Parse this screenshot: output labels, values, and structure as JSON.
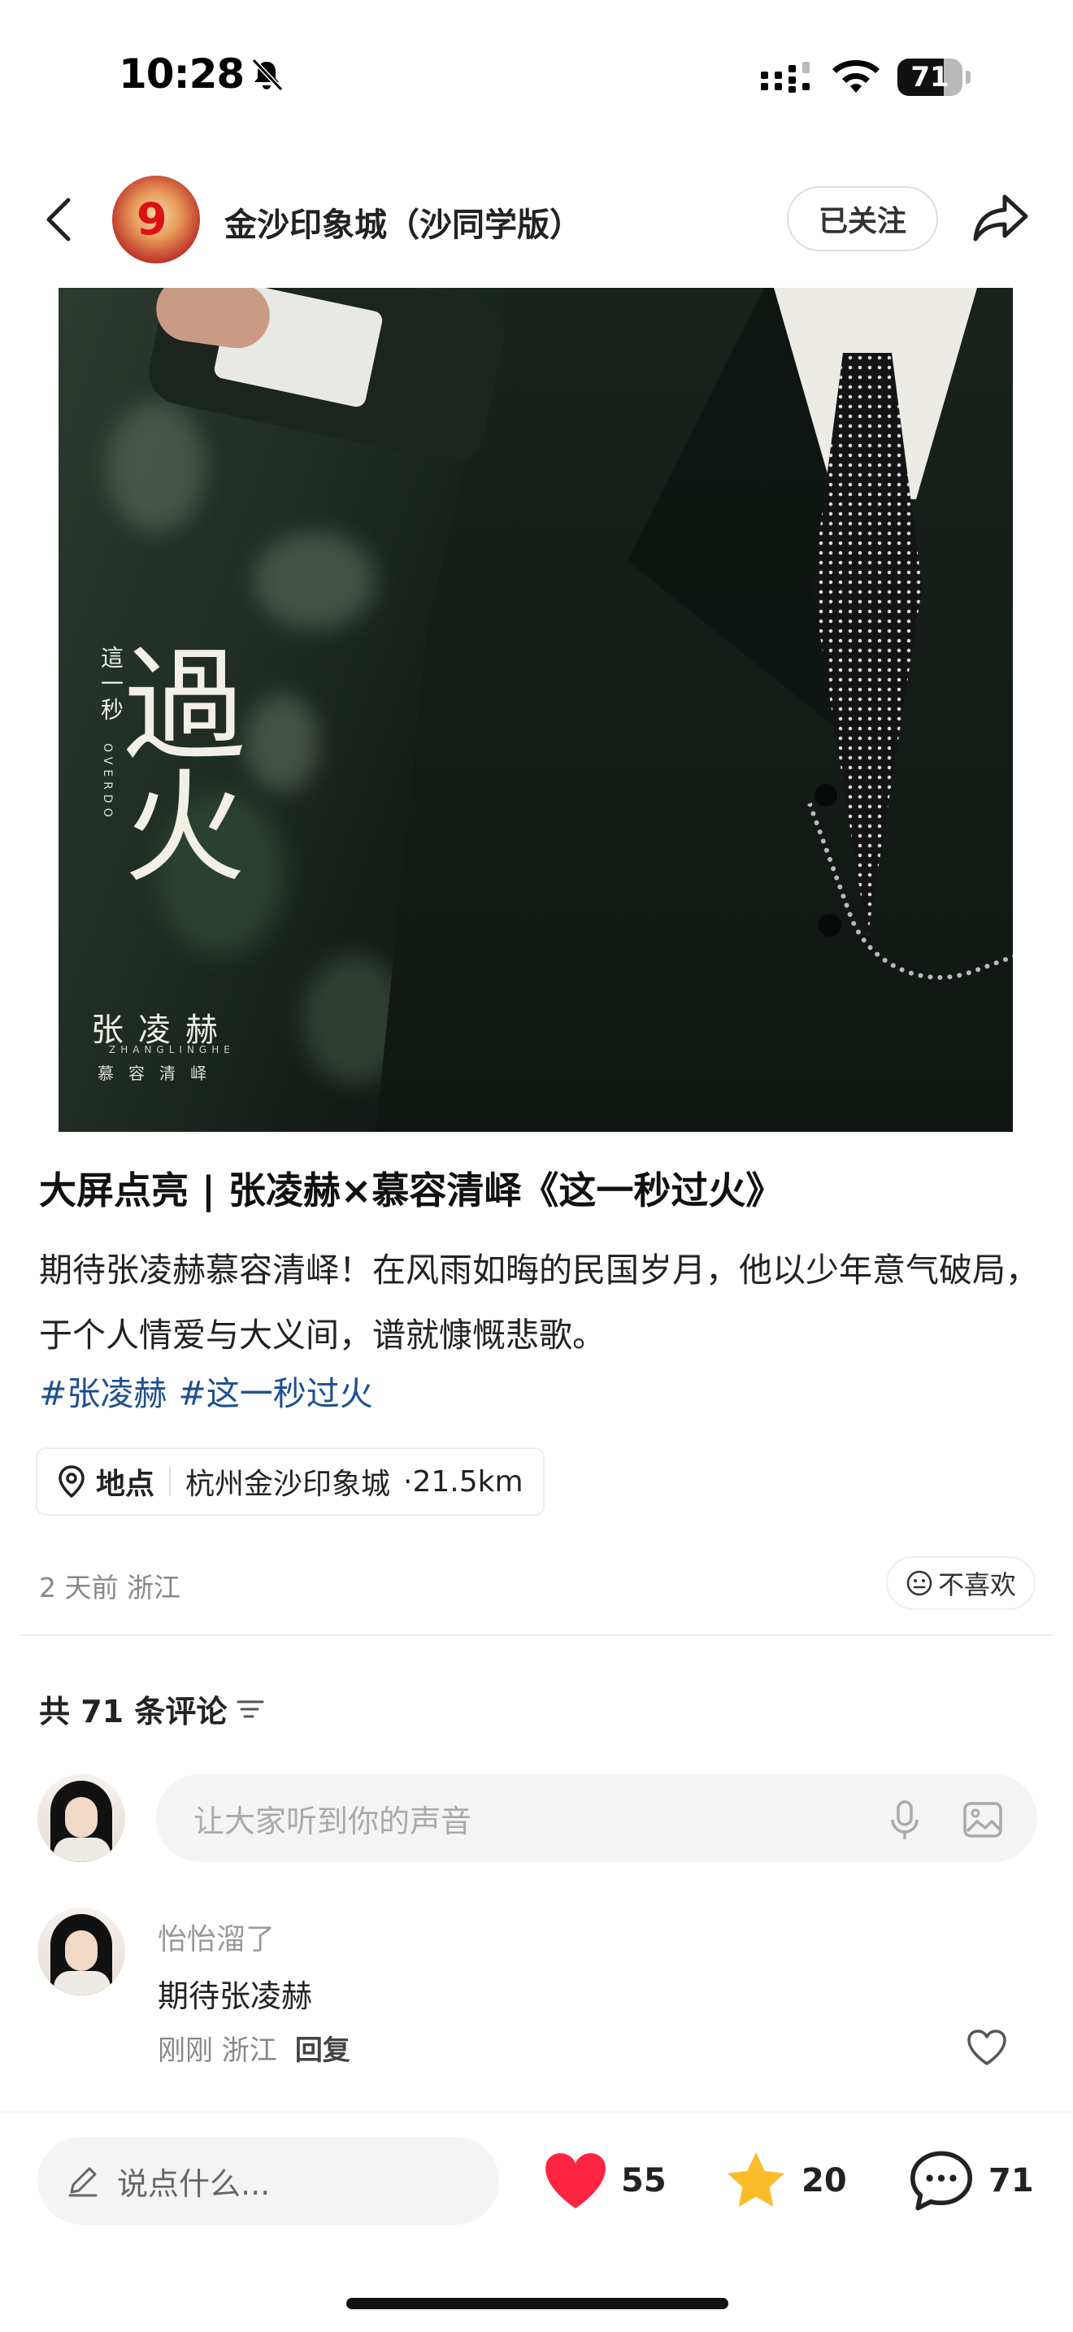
{
  "status_bar": {
    "time": "10:28",
    "battery": "71",
    "battery_level": 0.71
  },
  "header": {
    "account_name": "金沙印象城（沙同学版）",
    "follow_label": "已关注"
  },
  "poster": {
    "title_char_1": "過",
    "title_char_2": "火",
    "small_vertical": "這一秒",
    "overdo": "OVERDO",
    "artist": "张凌赫",
    "artist_en": "ZHANGLINGHE",
    "role": "慕容清峄"
  },
  "post": {
    "title": "大屏点亮 | 张凌赫×慕容清峄《这一秒过火》",
    "body": "期待张凌赫慕容清峄！在风雨如晦的民国岁月，他以少年意气破局，于个人情爱与大义间，谱就慷慨悲歌。",
    "tags": [
      "#张凌赫",
      "#这一秒过火"
    ],
    "location_label": "地点",
    "location_name": "杭州金沙印象城",
    "location_distance": "·21.5km",
    "time": "2 天前  浙江",
    "dislike_label": "不喜欢"
  },
  "comments": {
    "count_label": "共 71 条评论",
    "input_placeholder": "让大家听到你的声音",
    "items": [
      {
        "user": "怡怡溜了",
        "text": "期待张凌赫",
        "time": "刚刚  浙江",
        "reply_label": "回复"
      }
    ]
  },
  "bottom_bar": {
    "say_placeholder": "说点什么...",
    "likes": "55",
    "stars": "20",
    "comments": "71",
    "like_color": "#ff2442",
    "star_color": "#fbbc2a"
  },
  "icons": [
    "back-icon",
    "bell-slash-icon",
    "signal-icon",
    "wifi-icon",
    "battery-icon",
    "share-icon",
    "pin-icon",
    "neutral-face-icon",
    "sort-icon",
    "mic-icon",
    "image-icon",
    "heart-outline-icon",
    "pencil-icon",
    "heart-icon",
    "star-icon",
    "comment-icon"
  ]
}
